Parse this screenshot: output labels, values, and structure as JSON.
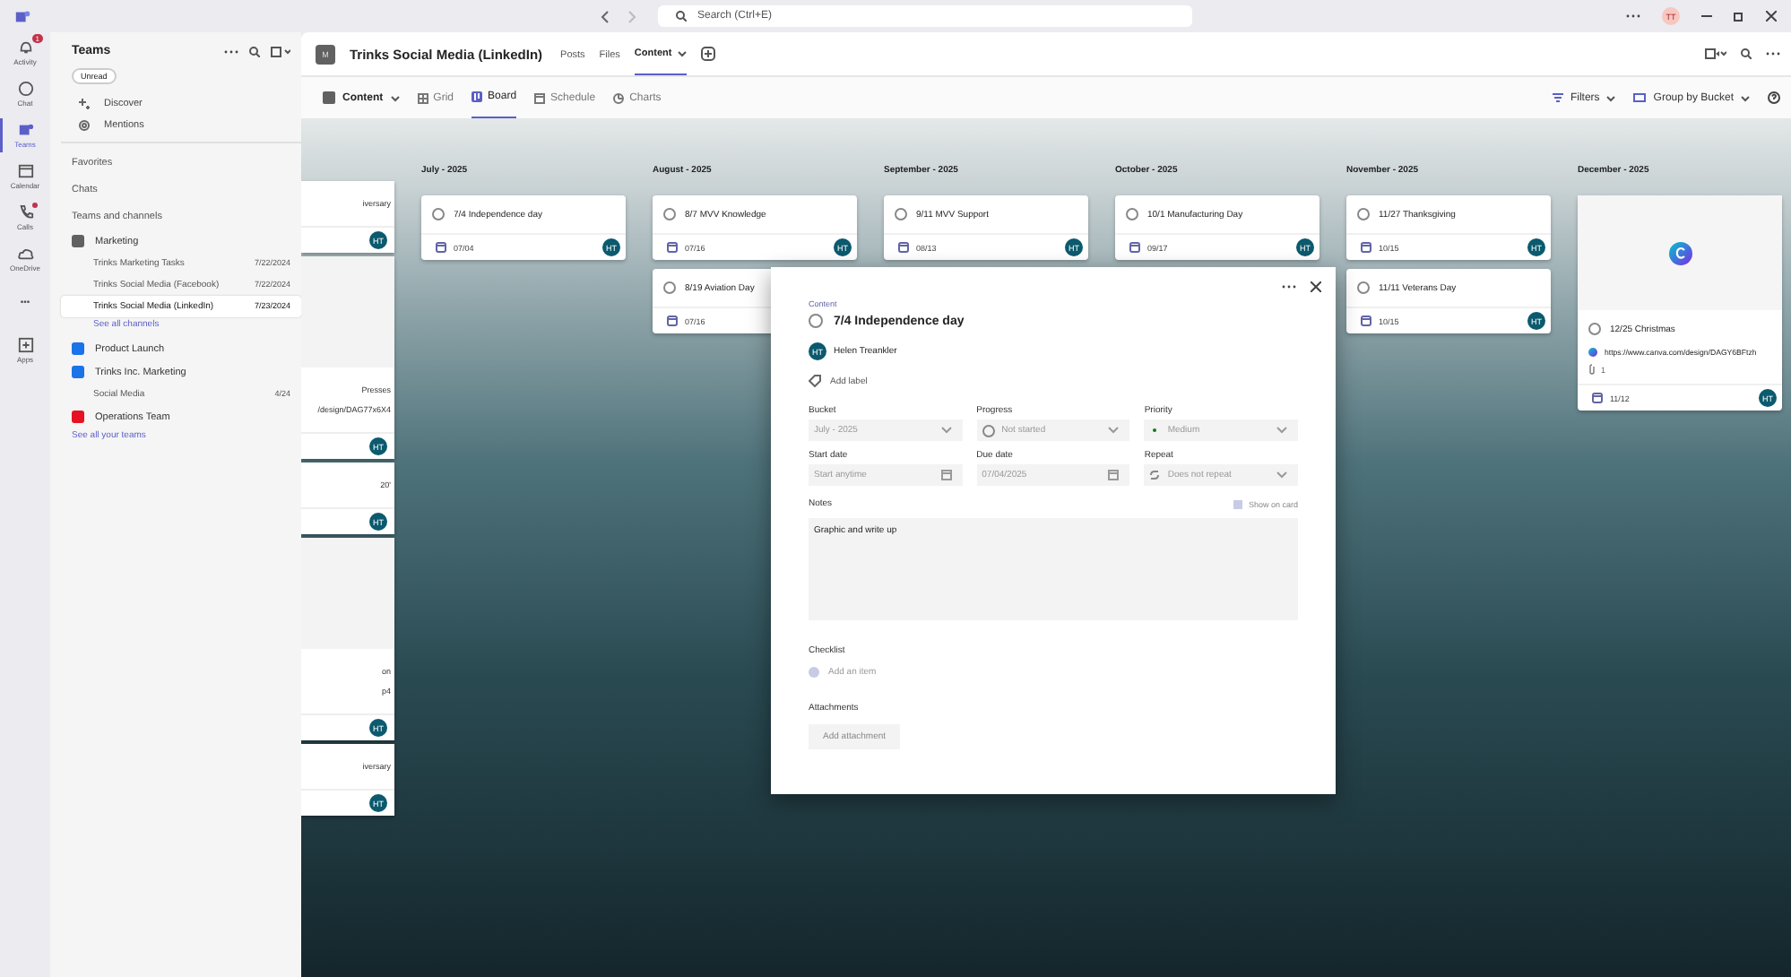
{
  "titlebar": {
    "search_placeholder": "Search (Ctrl+E)",
    "user_initials": "TT"
  },
  "rail": [
    {
      "label": "Activity",
      "kind": "bell",
      "badge": "1",
      "selected": false
    },
    {
      "label": "Chat",
      "kind": "chat",
      "selected": false
    },
    {
      "label": "Teams",
      "kind": "teams",
      "selected": true
    },
    {
      "label": "Calendar",
      "kind": "calendar",
      "selected": false
    },
    {
      "label": "Calls",
      "kind": "phone",
      "dot": true,
      "selected": false
    },
    {
      "label": "OneDrive",
      "kind": "cloud",
      "selected": false
    },
    {
      "label": "•••",
      "kind": "more",
      "selected": false
    },
    {
      "label": "Apps",
      "kind": "apps",
      "selected": false
    }
  ],
  "sidebar": {
    "title": "Teams",
    "filter": "Unread",
    "nav": [
      {
        "label": "Discover",
        "kind": "discover"
      },
      {
        "label": "Mentions",
        "kind": "mention"
      }
    ],
    "sections": [
      "Favorites",
      "Chats"
    ],
    "teams_heading": "Teams and channels",
    "teams": [
      {
        "name": "Marketing",
        "color": "#616161",
        "channels": [
          {
            "name": "Trinks Marketing Tasks",
            "date": "7/22/2024",
            "selected": false
          },
          {
            "name": "Trinks Social Media (Facebook)",
            "date": "7/22/2024",
            "selected": false
          },
          {
            "name": "Trinks Social Media (LinkedIn)",
            "date": "7/23/2024",
            "selected": true
          }
        ],
        "see_all": "See all channels"
      },
      {
        "name": "Product Launch",
        "color": "#1a73e8"
      },
      {
        "name": "Trinks Inc. Marketing",
        "color": "#1a73e8",
        "channels": [
          {
            "name": "Social Media",
            "date": "4/24",
            "selected": false
          }
        ]
      },
      {
        "name": "Operations Team",
        "color": "#e81123"
      }
    ],
    "see_all_teams": "See all your teams"
  },
  "channel": {
    "initial": "M",
    "title": "Trinks Social Media (LinkedIn)",
    "tabs": [
      {
        "label": "Posts",
        "selected": false
      },
      {
        "label": "Files",
        "selected": false
      },
      {
        "label": "Content",
        "selected": true
      }
    ]
  },
  "toolbar": {
    "plan": "Content",
    "views": [
      {
        "label": "Grid",
        "kind": "grid",
        "selected": false
      },
      {
        "label": "Board",
        "kind": "board",
        "selected": true
      },
      {
        "label": "Schedule",
        "kind": "schedule",
        "selected": false
      },
      {
        "label": "Charts",
        "kind": "charts",
        "selected": false
      }
    ],
    "filters": "Filters",
    "group_by": "Group by Bucket"
  },
  "partial_column": [
    {
      "image": false,
      "lines": [
        "iversary"
      ],
      "assignee": "HT"
    },
    {
      "image": true,
      "lines": [
        "Presses",
        "/design/DAG77x6X4"
      ],
      "assignee": "HT"
    },
    {
      "image": false,
      "lines": [
        "20'"
      ],
      "assignee": "HT"
    },
    {
      "image": true,
      "lines": [
        "on",
        "p4"
      ],
      "assignee": "HT"
    },
    {
      "image": false,
      "lines": [
        "iversary"
      ],
      "assignee": "HT"
    }
  ],
  "columns": [
    {
      "name": "July - 2025",
      "cards": [
        {
          "title": "7/4 Independence day",
          "completed": false,
          "date": "07/04",
          "assignee": "HT"
        }
      ]
    },
    {
      "name": "August - 2025",
      "cards": [
        {
          "title": "8/7 MVV Knowledge",
          "completed": false,
          "date": "07/16",
          "assignee": "HT"
        },
        {
          "title": "8/19 Aviation Day",
          "completed": false,
          "date": "07/16"
        }
      ]
    },
    {
      "name": "September - 2025",
      "cards": [
        {
          "title": "9/11 MVV Support",
          "completed": false,
          "date": "08/13",
          "assignee": "HT"
        }
      ]
    },
    {
      "name": "October - 2025",
      "cards": [
        {
          "title": "10/1 Manufacturing Day",
          "completed": false,
          "date": "09/17",
          "assignee": "HT"
        }
      ]
    },
    {
      "name": "November - 2025",
      "cards": [
        {
          "title": "11/27 Thanksgiving",
          "completed": false,
          "date": "10/15",
          "assignee": "HT"
        },
        {
          "title": "11/11 Veterans Day",
          "completed": false,
          "date": "10/15",
          "assignee": "HT"
        }
      ]
    },
    {
      "name": "December - 2025",
      "cards": [
        {
          "title": "12/25 Christmas",
          "completed": false,
          "date": "11/12",
          "assignee": "HT",
          "image": true,
          "link": "https://www.canva.com/design/DAGY6BFtzh",
          "attachments": "1"
        }
      ]
    }
  ],
  "dialog": {
    "plan": "Content",
    "title": "7/4 Independence day",
    "completed": false,
    "assignee": {
      "initials": "HT",
      "name": "Helen Treankler"
    },
    "add_label": "Add label",
    "fields": [
      {
        "label": "Bucket",
        "kind": "select",
        "value": "July - 2025"
      },
      {
        "label": "Progress",
        "kind": "progress",
        "value": "Not started"
      },
      {
        "label": "Priority",
        "kind": "priority",
        "value": "Medium"
      },
      {
        "label": "Start date",
        "kind": "date",
        "placeholder": "Start anytime"
      },
      {
        "label": "Due date",
        "kind": "date",
        "value": "07/04/2025"
      },
      {
        "label": "Repeat",
        "kind": "repeat",
        "value": "Does not repeat"
      }
    ],
    "notes_label": "Notes",
    "show_on_card": {
      "label": "Show on card",
      "checked": false
    },
    "notes": "Graphic and write up",
    "checklist_label": "Checklist",
    "checklist_placeholder": "Add an item",
    "attachments_label": "Attachments",
    "attachment_button": "Add attachment"
  }
}
